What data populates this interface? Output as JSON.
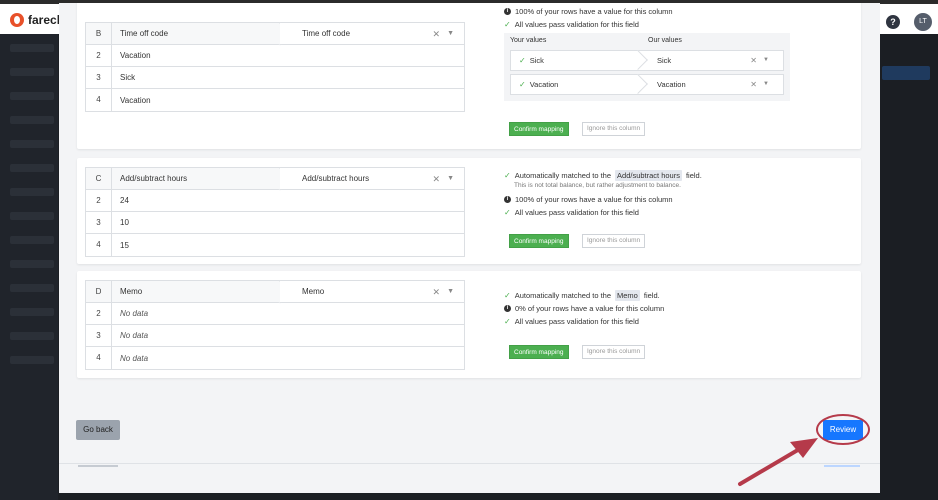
{
  "app": {
    "logo_text": "farecl",
    "help_icon": "?",
    "avatar_initials": "LT"
  },
  "card_b": {
    "col_letter": "B",
    "header": "Time off code",
    "selected_field": "Time off code",
    "rows": [
      {
        "n": "2",
        "v": "Vacation"
      },
      {
        "n": "3",
        "v": "Sick"
      },
      {
        "n": "4",
        "v": "Vacation"
      }
    ],
    "info_rows_pct": "100% of your rows have a value for this column",
    "info_valid": "All values pass validation for this field",
    "your_values_label": "Your values",
    "our_values_label": "Our values",
    "value_map": [
      {
        "yours": "Sick",
        "ours": "Sick"
      },
      {
        "yours": "Vacation",
        "ours": "Vacation"
      }
    ],
    "confirm_label": "Confirm mapping",
    "ignore_label": "Ignore this column"
  },
  "card_c": {
    "col_letter": "C",
    "header": "Add/subtract hours",
    "selected_field": "Add/subtract hours",
    "rows": [
      {
        "n": "2",
        "v": "24"
      },
      {
        "n": "3",
        "v": "10"
      },
      {
        "n": "4",
        "v": "15"
      }
    ],
    "matched_pre": "Automatically matched to the",
    "matched_field": "Add/subtract hours",
    "matched_post": "field.",
    "sub_note": "This is not total balance, but rather adjustment to balance.",
    "info_rows_pct": "100% of your rows have a value for this column",
    "info_valid": "All values pass validation for this field",
    "confirm_label": "Confirm mapping",
    "ignore_label": "Ignore this column"
  },
  "card_d": {
    "col_letter": "D",
    "header": "Memo",
    "selected_field": "Memo",
    "rows": [
      {
        "n": "2",
        "v": "No data"
      },
      {
        "n": "3",
        "v": "No data"
      },
      {
        "n": "4",
        "v": "No data"
      }
    ],
    "matched_pre": "Automatically matched to the",
    "matched_field": "Memo",
    "matched_post": "field.",
    "info_rows_pct": "0% of your rows have a value for this column",
    "info_valid": "All values pass validation for this field",
    "confirm_label": "Confirm mapping",
    "ignore_label": "Ignore this column"
  },
  "footer": {
    "go_back_label": "Go back",
    "review_label": "Review"
  },
  "colors": {
    "confirm_green": "#4caf50",
    "review_blue": "#1677ff",
    "annotation_red": "#b53a4a"
  }
}
